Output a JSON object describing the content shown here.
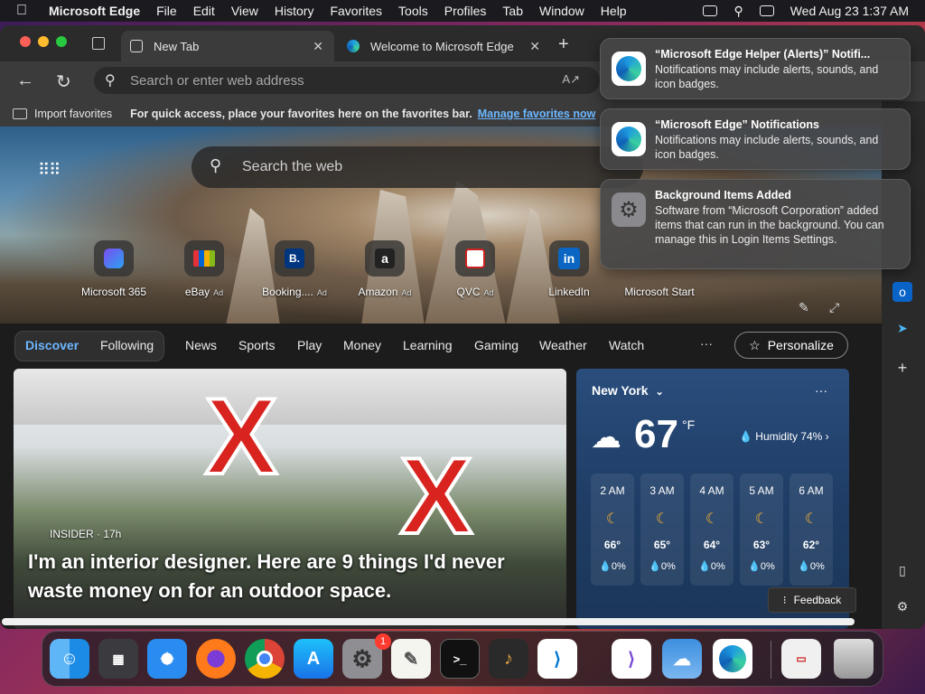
{
  "menubar": {
    "app_name": "Microsoft Edge",
    "items": [
      "File",
      "Edit",
      "View",
      "History",
      "Favorites",
      "Tools",
      "Profiles",
      "Tab",
      "Window",
      "Help"
    ],
    "datetime": "Wed Aug 23  1:37 AM"
  },
  "tabs": [
    {
      "label": "New Tab"
    },
    {
      "label": "Welcome to Microsoft Edge"
    }
  ],
  "address": {
    "placeholder": "Search or enter web address"
  },
  "favorites_bar": {
    "import_label": "Import favorites",
    "message": "For quick access, place your favorites here on the favorites bar.",
    "link": "Manage favorites now"
  },
  "newtab": {
    "search_placeholder": "Search the web",
    "quicklinks": [
      {
        "label": "Microsoft 365",
        "ad": ""
      },
      {
        "label": "eBay",
        "ad": "Ad"
      },
      {
        "label": "Booking....",
        "ad": "Ad"
      },
      {
        "label": "Amazon",
        "ad": "Ad"
      },
      {
        "label": "QVC",
        "ad": "Ad"
      },
      {
        "label": "LinkedIn",
        "ad": ""
      },
      {
        "label": "Microsoft Start",
        "ad": ""
      }
    ]
  },
  "feed": {
    "nav": [
      "Discover",
      "Following",
      "News",
      "Sports",
      "Play",
      "Money",
      "Learning",
      "Gaming",
      "Weather",
      "Watch"
    ],
    "more": "···",
    "personalize": "Personalize",
    "story": {
      "source": "INSIDER · 17h",
      "headline": "I'm an interior designer. Here are 9 things I'd never waste money on for an outdoor space."
    },
    "weather": {
      "city": "New York",
      "temp": "67",
      "unit": "°F",
      "humidity": "Humidity 74%",
      "hours": [
        {
          "time": "2 AM",
          "temp": "66°",
          "precip": "0%"
        },
        {
          "time": "3 AM",
          "temp": "65°",
          "precip": "0%"
        },
        {
          "time": "4 AM",
          "temp": "64°",
          "precip": "0%"
        },
        {
          "time": "5 AM",
          "temp": "63°",
          "precip": "0%"
        },
        {
          "time": "6 AM",
          "temp": "62°",
          "precip": "0%"
        }
      ]
    },
    "feedback": "Feedback"
  },
  "notifications": [
    {
      "title": "“Microsoft Edge Helper (Alerts)” Notifi...",
      "body": "Notifications may include alerts, sounds, and icon badges."
    },
    {
      "title": "“Microsoft Edge” Notifications",
      "body": "Notifications may include alerts, sounds, and icon badges."
    },
    {
      "title": "Background Items Added",
      "body": "Software from “Microsoft Corporation” added items that can run in the background. You can manage this in Login Items Settings."
    }
  ],
  "dock": {
    "apps": [
      "Finder",
      "Launchpad",
      "Safari",
      "Firefox",
      "Chrome",
      "App Store",
      "System Settings",
      "TextEdit",
      "Terminal",
      "GarageBand",
      "Visual Studio Code",
      "Visual Studio",
      "Weather",
      "Microsoft Edge",
      "Preview",
      "Trash"
    ],
    "settings_badge": "1"
  },
  "colors": {
    "accent": "#6cb7ff",
    "weather_bg": "#1f3d66",
    "notification_bg": "#464648"
  }
}
